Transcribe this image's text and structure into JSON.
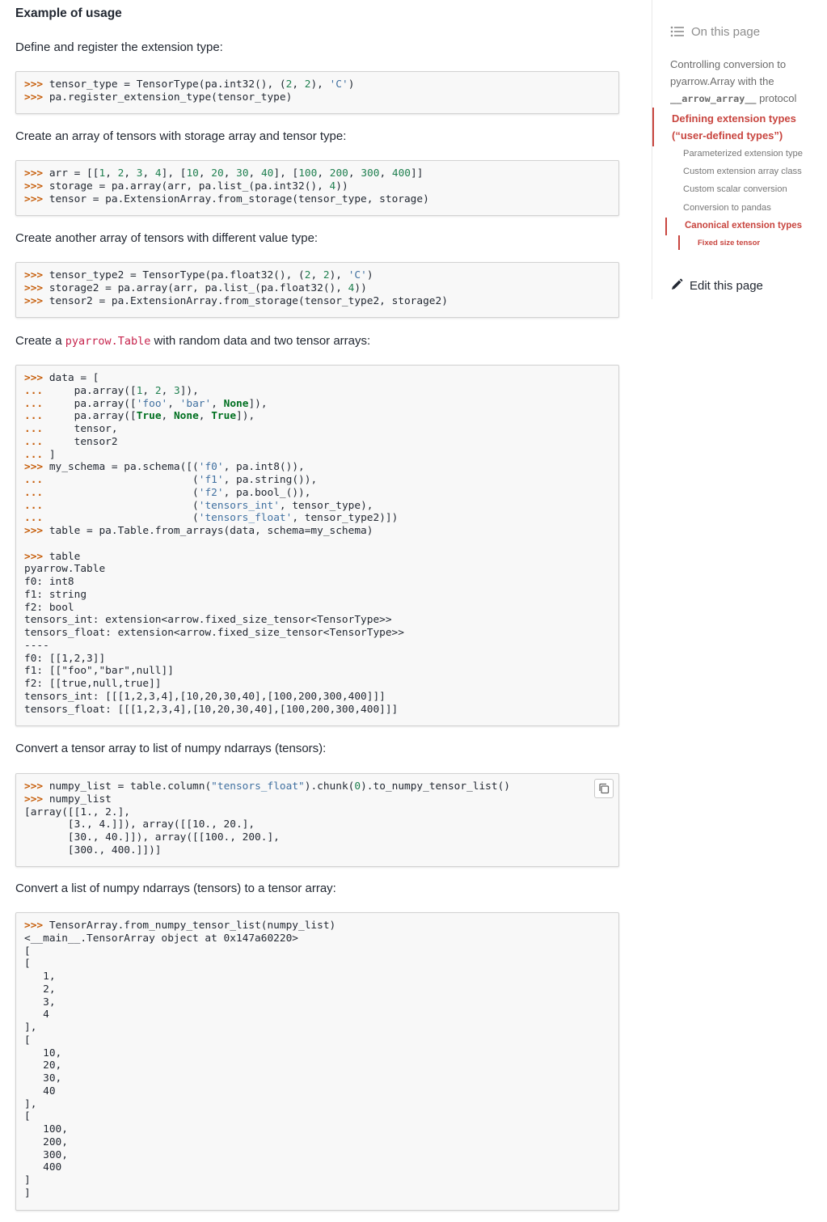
{
  "main": {
    "heading": "Example of usage",
    "para1": "Define and register the extension type:",
    "para2": "Create an array of tensors with storage array and tensor type:",
    "para3": "Create another array of tensors with different value type:",
    "para4_before": "Create a ",
    "para4_code": "pyarrow.Table",
    "para4_after": " with random data and two tensor arrays:",
    "para5": "Convert a tensor array to list of numpy ndarrays (tensors):",
    "para6": "Convert a list of numpy ndarrays (tensors) to a tensor array:",
    "copy_button_label": "copy-icon"
  },
  "sidebar": {
    "toc_title": "On this page",
    "toc_icon": "list-icon",
    "item1_line1": "Controlling conversion to",
    "item1_line2": "pyarrow.Array with the",
    "item1_code": "__arrow_array__",
    "item1_after": " protocol",
    "item2_line1": "Defining extension types",
    "item2_line2": "(“user-defined types”)",
    "sub1": "Parameterized extension type",
    "sub2": "Custom extension array class",
    "sub3": "Custom scalar conversion",
    "sub4": "Conversion to pandas",
    "sub5": "Canonical extension types",
    "subsub1": "Fixed size tensor",
    "edit_label": "Edit this page",
    "edit_icon": "pencil-icon",
    "accent": "#c8453f"
  }
}
